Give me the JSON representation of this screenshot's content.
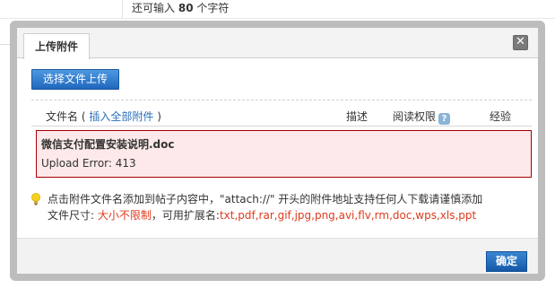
{
  "background": {
    "remaining_prefix": "还可输入",
    "remaining_count": "80",
    "remaining_suffix": "个字符"
  },
  "dialog": {
    "tab_label": "上传附件",
    "close_label": "✕",
    "upload_button_label": "选择文件上传",
    "table_header": {
      "filename": "文件名",
      "filename_paren_open": "(",
      "insert_all_link": "插入全部附件",
      "filename_paren_close": ")",
      "description": "描述",
      "read_permission": "阅读权限",
      "help_icon_glyph": "?",
      "price": "经验"
    },
    "error_item": {
      "file_name": "微信支付配置安装说明.doc",
      "error_message": "Upload Error: 413"
    },
    "tips": {
      "line1": "点击附件文件名添加到帖子内容中，\"attach://\" 开头的附件地址支持任何人下载请谨慎添加",
      "size_label": "文件尺寸:",
      "size_value": "大小不限制",
      "ext_label": "，可用扩展名:",
      "ext_value": "txt,pdf,rar,gif,jpg,png,avi,flv,rm,doc,wps,xls,ppt"
    },
    "ok_button_label": "确定"
  },
  "colors": {
    "accent_blue": "#1f67bd",
    "error_border": "#a30000",
    "error_bg": "#fde9e9",
    "highlight_red": "#e03b1d",
    "link": "#2a6fb9"
  }
}
